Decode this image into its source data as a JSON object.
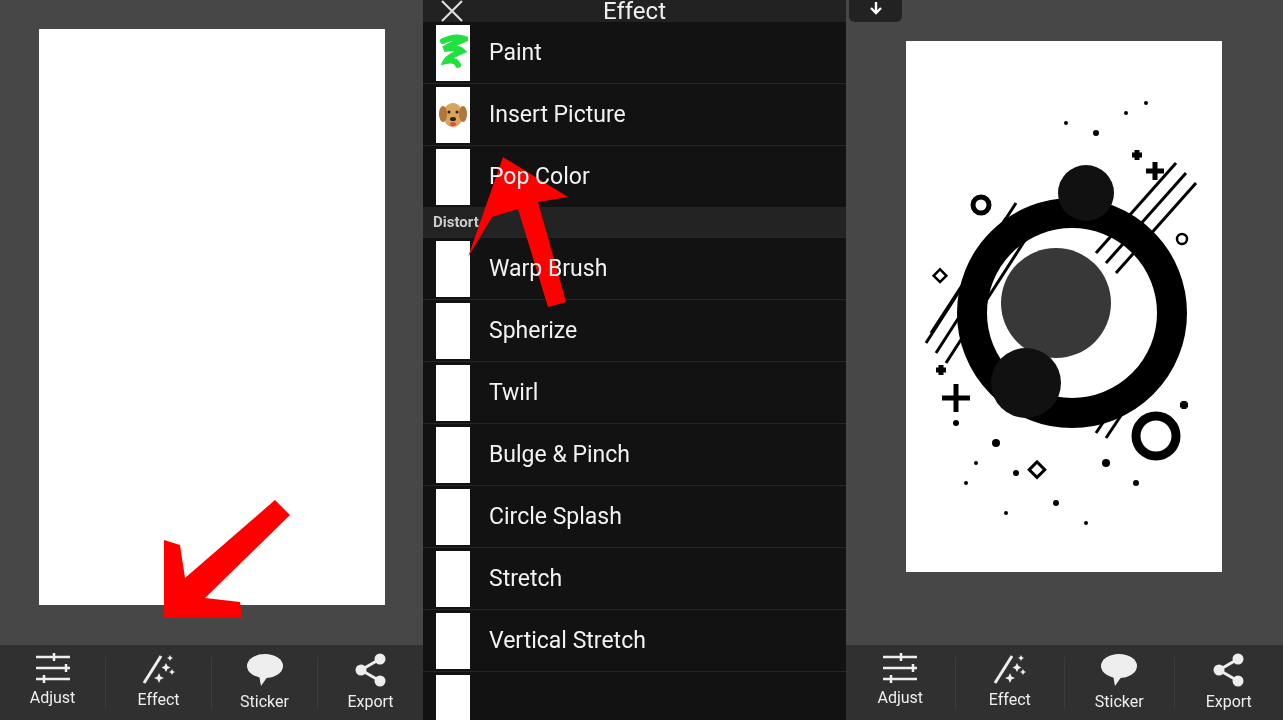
{
  "left_screen": {
    "toolbar": [
      {
        "label": "Adjust",
        "kind": "adjust"
      },
      {
        "label": "Effect",
        "kind": "effect"
      },
      {
        "label": "Sticker",
        "kind": "sticker"
      },
      {
        "label": "Export",
        "kind": "export"
      }
    ]
  },
  "middle_screen": {
    "title": "Effect",
    "sections": [
      {
        "items": [
          {
            "label": "Paint",
            "kind": "paint"
          },
          {
            "label": "Insert Picture",
            "kind": "photo"
          },
          {
            "label": "Pop Color",
            "kind": "blank"
          }
        ]
      },
      {
        "header": "Distort",
        "items": [
          {
            "label": "Warp Brush",
            "kind": "blank"
          },
          {
            "label": "Spherize",
            "kind": "blank"
          },
          {
            "label": "Twirl",
            "kind": "blank"
          },
          {
            "label": "Bulge & Pinch",
            "kind": "blank"
          },
          {
            "label": "Circle Splash",
            "kind": "blank"
          },
          {
            "label": "Stretch",
            "kind": "blank"
          },
          {
            "label": "Vertical Stretch",
            "kind": "blank"
          },
          {
            "kind": "blank"
          }
        ]
      }
    ]
  },
  "right_screen": {
    "toolbar": [
      {
        "label": "Adjust",
        "kind": "adjust"
      },
      {
        "label": "Effect",
        "kind": "effect"
      },
      {
        "label": "Sticker",
        "kind": "sticker"
      },
      {
        "label": "Export",
        "kind": "export"
      }
    ]
  }
}
